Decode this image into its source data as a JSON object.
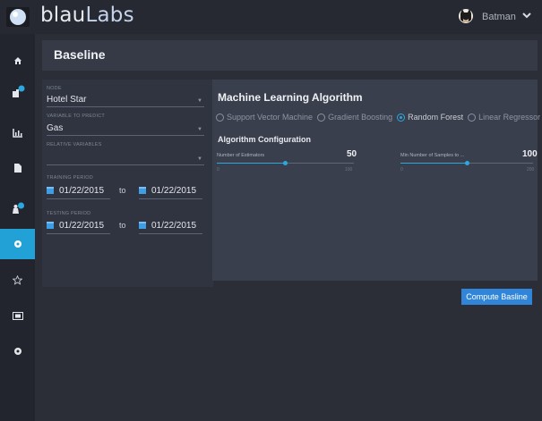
{
  "app": {
    "brand_main": "blau",
    "brand_accent": "Labs",
    "user_name": "Batman",
    "accent_color": "#21a1d6"
  },
  "sidebar": {
    "items": [
      {
        "icon": "home-icon",
        "active": false
      },
      {
        "icon": "sensor-icon",
        "active": false
      },
      {
        "icon": "chart-icon",
        "active": false
      },
      {
        "icon": "document-icon",
        "active": false
      },
      {
        "icon": "user-icon",
        "active": false
      },
      {
        "icon": "baseline-icon",
        "active": true
      },
      {
        "icon": "star-icon",
        "active": false
      },
      {
        "icon": "id-card-icon",
        "active": false
      },
      {
        "icon": "settings-icon",
        "active": false
      }
    ]
  },
  "page": {
    "title": "Baseline"
  },
  "form": {
    "node_label": "NODE",
    "node_value": "Hotel Star",
    "variable_label": "VARIABLE TO PREDICT",
    "variable_value": "Gas",
    "relative_label": "RELATIVE VARIABLES",
    "relative_value": "",
    "training_label": "TRAINING PERIOD",
    "training_from": "01/22/2015",
    "training_to": "01/22/2015",
    "testing_label": "TESTING PERIOD",
    "testing_from": "01/22/2015",
    "testing_to": "01/22/2015",
    "to_text": "to"
  },
  "ml": {
    "title": "Machine Learning Algorithm",
    "options": [
      {
        "label": "Support Vector Machine",
        "checked": false
      },
      {
        "label": "Gradient Boosting",
        "checked": false
      },
      {
        "label": "Random Forest",
        "checked": true
      },
      {
        "label": "Linear Regressor",
        "checked": false
      }
    ],
    "config_title": "Algorithm Configuration",
    "slider1": {
      "label": "Number of Estimators",
      "value": "50",
      "min": "0",
      "max": "100",
      "fraction": 0.5
    },
    "slider2": {
      "label": "Min Number of Samples to ...",
      "value": "100",
      "min": "0",
      "max": "200",
      "fraction": 0.5
    },
    "compute_label": "Compute Basline"
  }
}
